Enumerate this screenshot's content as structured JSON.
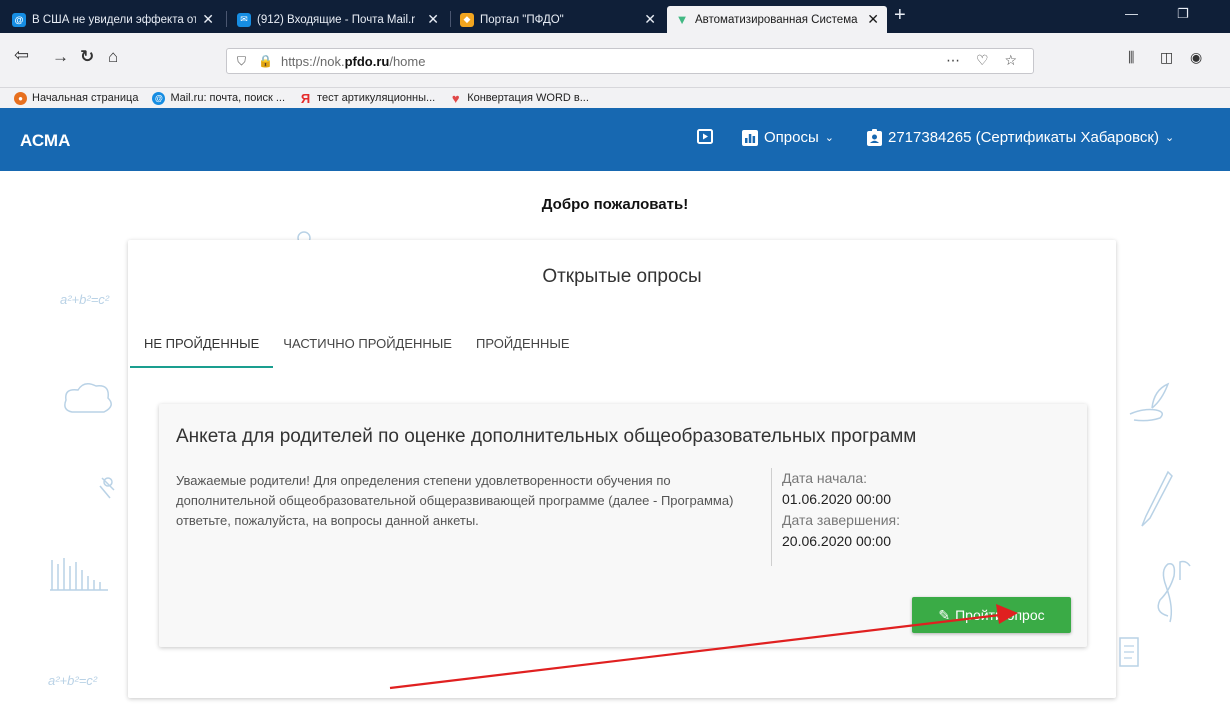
{
  "browser": {
    "tabs": [
      {
        "title": "В США не увидели эффекта от",
        "favicon_color": "#168de2"
      },
      {
        "title": "(912) Входящие - Почта Mail.r",
        "favicon_color": "#168de2"
      },
      {
        "title": "Портал \"ПФДО\"",
        "favicon_color": "#f2a51f"
      },
      {
        "title": "Автоматизированная Система",
        "favicon_color": "#41b883"
      }
    ],
    "url_prefix": "https://nok.",
    "url_domain": "pfdo.ru",
    "url_path": "/home",
    "bookmarks": [
      {
        "label": "Начальная страница",
        "color": "#e76f1e"
      },
      {
        "label": "Mail.ru: почта, поиск ...",
        "color": "#168de2"
      },
      {
        "label": "тест артикуляционны...",
        "color": "#e52b2b"
      },
      {
        "label": "Конвертация WORD в...",
        "color": "#e04848"
      }
    ]
  },
  "app": {
    "brand": "АСМА",
    "surveys_menu": "Опросы",
    "user_menu": "2717384265 (Сертификаты Хабаровск)",
    "accent_color": "#1768b1"
  },
  "content": {
    "welcome": "Добро пожаловать!",
    "card_title": "Открытые опросы",
    "tabs": [
      "НЕ ПРОЙДЕННЫЕ",
      "ЧАСТИЧНО ПРОЙДЕННЫЕ",
      "ПРОЙДЕННЫЕ"
    ],
    "active_tab": "НЕ ПРОЙДЕННЫЕ",
    "survey": {
      "title": "Анкета для родителей по оценке дополнительных общеобразовательных программ",
      "description": "Уважаемые родители! Для определения степени удовлетворенности обучения по дополнительной общеобразовательной общеразвивающей программе (далее - Программа) ответьте, пожалуйста, на вопросы данной анкеты.",
      "start_label": "Дата начала:",
      "start_value": "01.06.2020 00:00",
      "end_label": "Дата завершения:",
      "end_value": "20.06.2020 00:00",
      "button_label": "Пройти опрос",
      "button_color": "#3aab46"
    }
  },
  "icons": {
    "back": "back-arrow-icon",
    "forward": "forward-arrow-icon",
    "reload": "reload-icon",
    "home": "home-icon",
    "video": "video-icon",
    "chart": "bar-chart-icon",
    "badge": "badge-icon"
  }
}
